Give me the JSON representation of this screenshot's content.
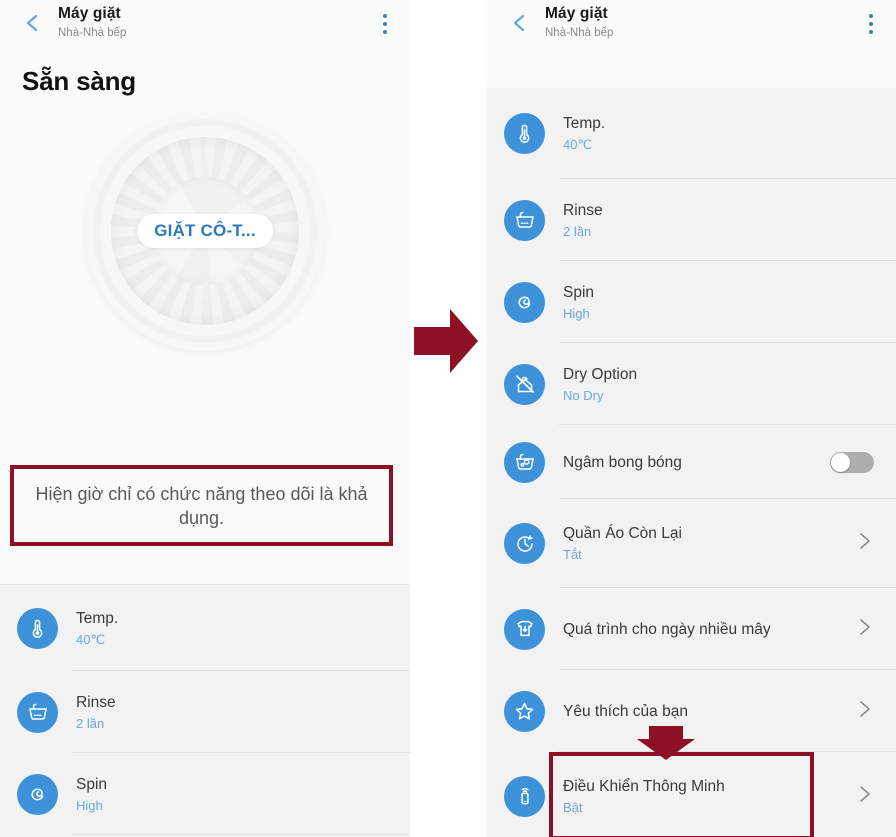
{
  "header": {
    "title": "Máy giặt",
    "subtitle": "Nhà-Nhà bếp",
    "back_icon": "chevron-left-icon",
    "menu_icon": "kebab-menu-icon"
  },
  "left_panel": {
    "status": "Sẵn sàng",
    "dial": {
      "course_label": "GIẶT CÔ-T...",
      "icon": "washer-drum-icon"
    },
    "notice": "Hiện giờ chỉ có chức năng theo dõi là khả dụng.",
    "rows": [
      {
        "icon": "thermometer-icon",
        "title": "Temp.",
        "value": "40℃",
        "control": "none"
      },
      {
        "icon": "rinse-basin-icon",
        "title": "Rinse",
        "value": "2 lần",
        "control": "none"
      },
      {
        "icon": "spin-spiral-icon",
        "title": "Spin",
        "value": "High",
        "control": "none"
      }
    ]
  },
  "right_panel": {
    "rows": [
      {
        "icon": "thermometer-icon",
        "title": "Temp.",
        "value": "40℃",
        "control": "none",
        "highlighted": false
      },
      {
        "icon": "rinse-basin-icon",
        "title": "Rinse",
        "value": "2 lần",
        "control": "none",
        "highlighted": false
      },
      {
        "icon": "spin-spiral-icon",
        "title": "Spin",
        "value": "High",
        "control": "none",
        "highlighted": false
      },
      {
        "icon": "no-dry-icon",
        "title": "Dry Option",
        "value": "No Dry",
        "control": "none",
        "highlighted": false
      },
      {
        "icon": "bubble-soak-icon",
        "title": "Ngâm bong bóng",
        "value": "",
        "control": "toggle",
        "toggle_state": "off",
        "highlighted": false
      },
      {
        "icon": "clock-icon",
        "title": "Quần Áo Còn Lại",
        "value": "Tắt",
        "control": "chevron",
        "highlighted": false
      },
      {
        "icon": "tshirt-down-arrow-icon",
        "title": "Quá trình cho ngày nhiều mây",
        "value": "",
        "control": "chevron",
        "highlighted": false
      },
      {
        "icon": "star-icon",
        "title": "Yêu thích của bạn",
        "value": "",
        "control": "chevron",
        "highlighted": false
      },
      {
        "icon": "remote-control-icon",
        "title": "Điều Khiển Thông Minh",
        "value": "Bật",
        "control": "chevron",
        "highlighted": true
      }
    ]
  },
  "annotations": {
    "flow_arrow": "arrow-right-icon",
    "pointer_arrow": "arrow-down-icon",
    "highlight_color": "#8d1026",
    "accent_color": "#3d92d9",
    "value_color": "#6fa8dc"
  }
}
